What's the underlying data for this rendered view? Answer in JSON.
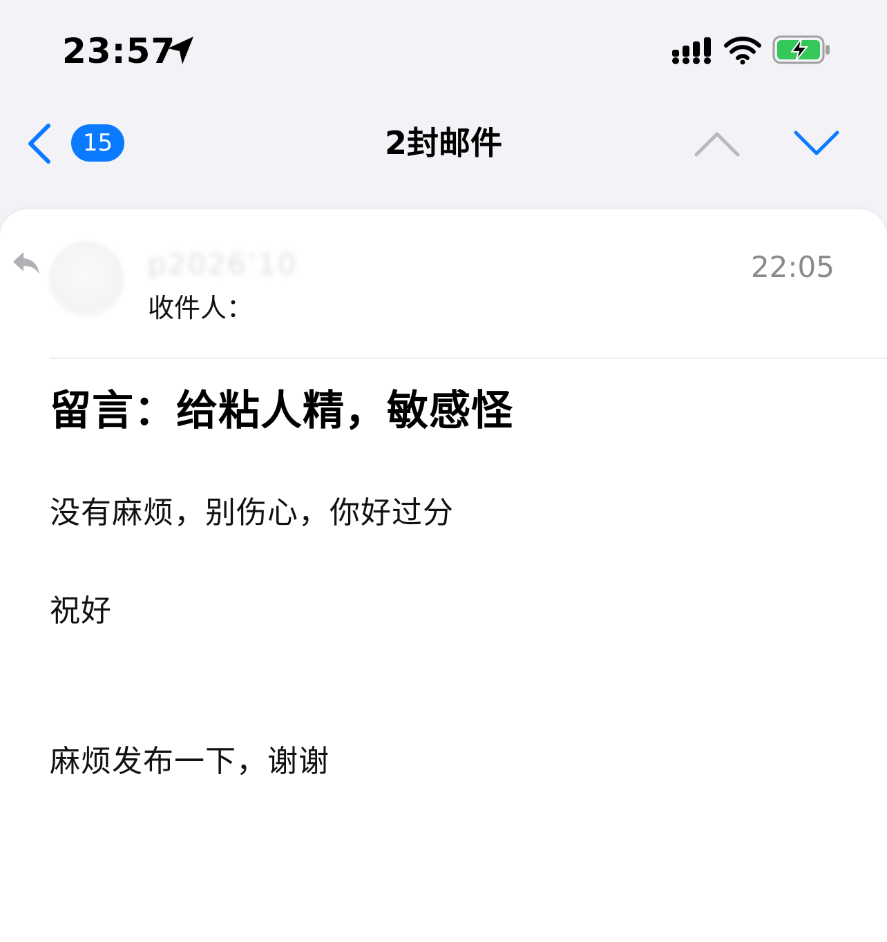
{
  "status_bar": {
    "time": "23:57",
    "icons": [
      "location-arrow-icon",
      "cellular-signal-icon",
      "wifi-icon",
      "battery-charging-icon"
    ],
    "battery_color": "#34c759"
  },
  "nav": {
    "back_icon": "chevron-left-icon",
    "unread_count": "15",
    "title": "2封邮件",
    "prev_icon": "chevron-up-icon",
    "next_icon": "chevron-down-icon",
    "accent_color": "#0a7aff"
  },
  "message": {
    "reply_icon": "reply-icon",
    "sender": "p⁢2026’10",
    "time": "22:05",
    "to_label": "收件人：",
    "subject": "留言：给粘人精，敏感怪",
    "body": [
      "没有麻烦，别伤心，你好过分",
      "祝好",
      "麻烦发布一下，谢谢"
    ]
  }
}
